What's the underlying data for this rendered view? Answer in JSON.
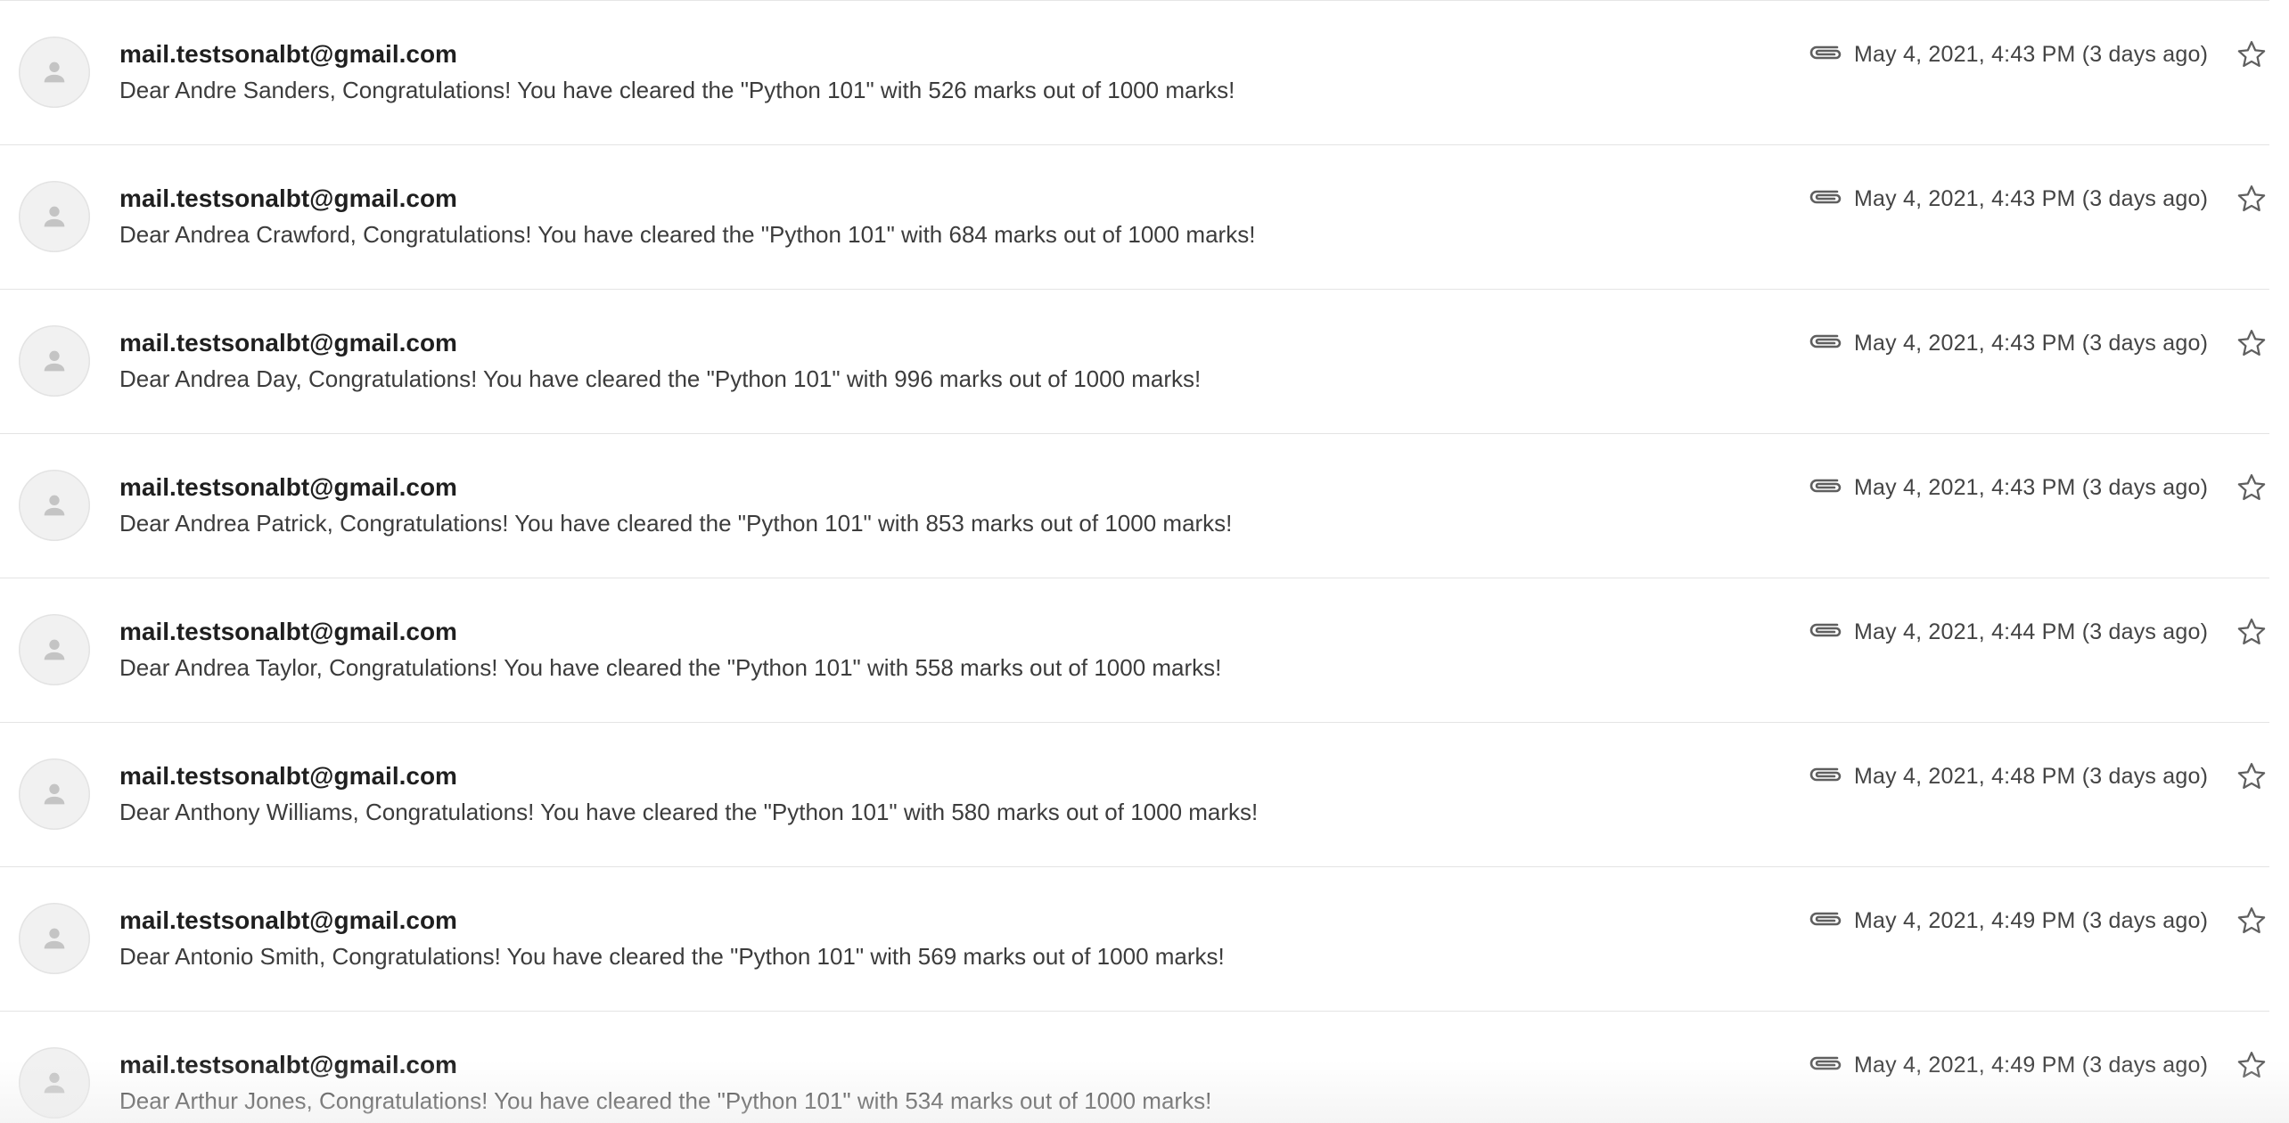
{
  "inbox": {
    "messages": [
      {
        "sender": "mail.testsonalbt@gmail.com",
        "snippet": "Dear Andre Sanders, Congratulations! You have cleared the \"Python 101\" with 526 marks out of 1000 marks!",
        "time": "May 4, 2021, 4:43 PM (3 days ago)",
        "has_attachment": true,
        "starred": false
      },
      {
        "sender": "mail.testsonalbt@gmail.com",
        "snippet": "Dear Andrea Crawford, Congratulations! You have cleared the \"Python 101\" with 684 marks out of 1000 marks!",
        "time": "May 4, 2021, 4:43 PM (3 days ago)",
        "has_attachment": true,
        "starred": false
      },
      {
        "sender": "mail.testsonalbt@gmail.com",
        "snippet": "Dear Andrea Day, Congratulations! You have cleared the \"Python 101\" with 996 marks out of 1000 marks!",
        "time": "May 4, 2021, 4:43 PM (3 days ago)",
        "has_attachment": true,
        "starred": false
      },
      {
        "sender": "mail.testsonalbt@gmail.com",
        "snippet": "Dear Andrea Patrick, Congratulations! You have cleared the \"Python 101\" with 853 marks out of 1000 marks!",
        "time": "May 4, 2021, 4:43 PM (3 days ago)",
        "has_attachment": true,
        "starred": false
      },
      {
        "sender": "mail.testsonalbt@gmail.com",
        "snippet": "Dear Andrea Taylor, Congratulations! You have cleared the \"Python 101\" with 558 marks out of 1000 marks!",
        "time": "May 4, 2021, 4:44 PM (3 days ago)",
        "has_attachment": true,
        "starred": false
      },
      {
        "sender": "mail.testsonalbt@gmail.com",
        "snippet": "Dear Anthony Williams, Congratulations! You have cleared the \"Python 101\" with 580 marks out of 1000 marks!",
        "time": "May 4, 2021, 4:48 PM (3 days ago)",
        "has_attachment": true,
        "starred": false
      },
      {
        "sender": "mail.testsonalbt@gmail.com",
        "snippet": "Dear Antonio Smith, Congratulations! You have cleared the \"Python 101\" with 569 marks out of 1000 marks!",
        "time": "May 4, 2021, 4:49 PM (3 days ago)",
        "has_attachment": true,
        "starred": false
      },
      {
        "sender": "mail.testsonalbt@gmail.com",
        "snippet": "Dear Arthur Jones, Congratulations! You have cleared the \"Python 101\" with 534 marks out of 1000 marks!",
        "time": "May 4, 2021, 4:49 PM (3 days ago)",
        "has_attachment": true,
        "starred": false
      }
    ]
  },
  "icons": {
    "avatar": "person-icon",
    "attachment": "paperclip-icon",
    "star": "star-outline-icon"
  },
  "colors": {
    "sender_text": "#1f1f1f",
    "snippet_text": "#3c3c3c",
    "timestamp_text": "#444444",
    "avatar_bg": "#f1f1f1",
    "avatar_glyph": "#c4c4c4",
    "icon_gray": "#5f5f5f",
    "divider": "#e4e4e4"
  }
}
